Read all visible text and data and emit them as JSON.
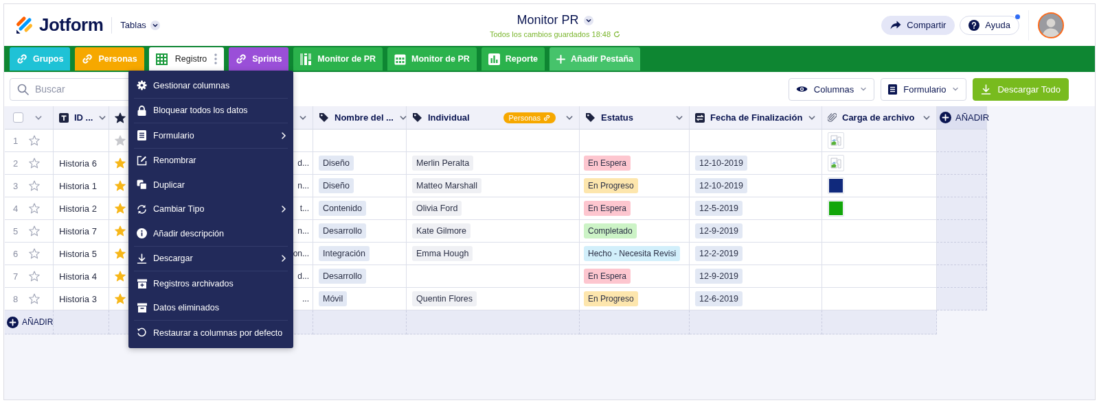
{
  "header": {
    "brand": "Jotform",
    "menu_label": "Tablas",
    "title": "Monitor PR",
    "save_status": "Todos los cambios guardados 18:48",
    "buttons": [
      {
        "label": "Compartir",
        "kind": "share",
        "notification": false
      },
      {
        "label": "Ayuda",
        "kind": "help",
        "notification": true
      }
    ]
  },
  "tabs": [
    {
      "label": "Grupos",
      "kind": "link",
      "color": "#1fc2d6",
      "selected": false
    },
    {
      "label": "Personas",
      "kind": "link",
      "color": "#f6a800",
      "selected": false
    },
    {
      "label": "Registro",
      "kind": "table",
      "color": "#1c9b3e",
      "selected": true
    },
    {
      "label": "Sprints",
      "kind": "link",
      "color": "#9a4fd8",
      "selected": false
    },
    {
      "label": "Monitor de PR",
      "kind": "monitor",
      "color": "#2bb24c",
      "selected": false
    },
    {
      "label": "Monitor de PR",
      "kind": "calendar",
      "color": "#2bb24c",
      "selected": false
    },
    {
      "label": "Reporte",
      "kind": "report",
      "color": "#2bb24c",
      "selected": false
    },
    {
      "label": "Añadir Pestaña",
      "kind": "add",
      "color": "#46c36b",
      "selected": false
    }
  ],
  "toolbar": {
    "search": {
      "placeholder": "Buscar"
    },
    "buttons": [
      {
        "label": "Columnas",
        "kind": "columns"
      },
      {
        "label": "Formulario",
        "kind": "form"
      },
      {
        "label": "Descargar Todo",
        "kind": "download"
      }
    ]
  },
  "table": {
    "columns": [
      {
        "kind": "select",
        "checked": false
      },
      {
        "kind": "text",
        "label": "ID ..."
      },
      {
        "kind": "star"
      },
      {
        "kind": "covered"
      },
      {
        "kind": "tag",
        "label": "Nombre del ..."
      },
      {
        "kind": "tag",
        "label": "Individual",
        "link_badge": "Personas"
      },
      {
        "kind": "tag",
        "label": "Estatus"
      },
      {
        "kind": "date",
        "label": "Fecha de Finalización"
      },
      {
        "kind": "file",
        "label": "Carga de archivo"
      },
      {
        "kind": "add",
        "label": "AÑADIR"
      }
    ],
    "rows": [
      {
        "number": "1",
        "starred": false,
        "file": {
          "kind": "broken"
        }
      },
      {
        "number": "2",
        "id": "Historia 6",
        "starred": true,
        "column_4": "d...",
        "nombre": "Diseño",
        "individual": "Merlin Peralta",
        "estatus": {
          "label": "En Espera",
          "color": "#fdc6cf"
        },
        "fecha": "12-10-2019",
        "file": {
          "kind": "broken"
        }
      },
      {
        "number": "3",
        "id": "Historia 1",
        "starred": true,
        "column_4": "n...",
        "nombre": "Diseño",
        "individual": "Matteo Marshall",
        "estatus": {
          "label": "En Progreso",
          "color": "#fde6ad"
        },
        "fecha": "12-10-2019",
        "file": {
          "kind": "image",
          "color": "#10297c"
        }
      },
      {
        "number": "4",
        "id": "Historia 2",
        "starred": true,
        "column_4": "t...",
        "nombre": "Contenido",
        "individual": "Olivia Ford",
        "estatus": {
          "label": "En Espera",
          "color": "#fdc6cf"
        },
        "fecha": "12-5-2019",
        "file": {
          "kind": "image",
          "color": "#12a60a"
        }
      },
      {
        "number": "5",
        "id": "Historia 7",
        "starred": true,
        "column_4": "n...",
        "nombre": "Desarrollo",
        "individual": "Kate Gilmore",
        "estatus": {
          "label": "Completado",
          "color": "#ccf3c6"
        },
        "fecha": "12-9-2019"
      },
      {
        "number": "6",
        "id": "Historia 5",
        "starred": true,
        "column_4": "on...",
        "nombre": "Integración",
        "individual": "Emma Hough",
        "estatus": {
          "label": "Hecho - Necesita Revisi",
          "color": "#d2effb"
        },
        "fecha": "12-2-2019"
      },
      {
        "number": "7",
        "id": "Historia 4",
        "starred": true,
        "column_4": "d...",
        "nombre": "Desarrollo",
        "estatus": {
          "label": "En Espera",
          "color": "#fdc6cf"
        },
        "fecha": "12-9-2019"
      },
      {
        "number": "8",
        "id": "Historia 3",
        "starred": true,
        "column_4": "...",
        "nombre": "Móvil",
        "individual": "Quentin Flores",
        "estatus": {
          "label": "En Progreso",
          "color": "#fde6ad"
        },
        "fecha": "12-6-2019"
      }
    ],
    "add_row": "AÑADIR"
  },
  "menu": {
    "items": [
      {
        "label": "Gestionar columnas",
        "kind": "manage",
        "submenu": false,
        "divider_after": true
      },
      {
        "label": "Bloquear todos los datos",
        "kind": "lock",
        "submenu": false,
        "divider_after": true
      },
      {
        "label": "Formulario",
        "kind": "form",
        "submenu": true,
        "divider_after": true
      },
      {
        "label": "Renombrar",
        "kind": "rename",
        "submenu": false,
        "divider_after": false
      },
      {
        "label": "Duplicar",
        "kind": "duplicate",
        "submenu": false,
        "divider_after": false
      },
      {
        "label": "Cambiar Tipo",
        "kind": "change-type",
        "submenu": true,
        "divider_after": false
      },
      {
        "label": "Añadir descripción",
        "kind": "describe",
        "submenu": false,
        "divider_after": true
      },
      {
        "label": "Descargar",
        "kind": "download",
        "submenu": true,
        "divider_after": true
      },
      {
        "label": "Registros archivados",
        "kind": "archived",
        "submenu": false,
        "divider_after": false
      },
      {
        "label": "Datos eliminados",
        "kind": "deleted",
        "submenu": false,
        "divider_after": true
      },
      {
        "label": "Restaurar a columnas por defecto",
        "kind": "restore",
        "submenu": false,
        "divider_after": false
      }
    ]
  }
}
